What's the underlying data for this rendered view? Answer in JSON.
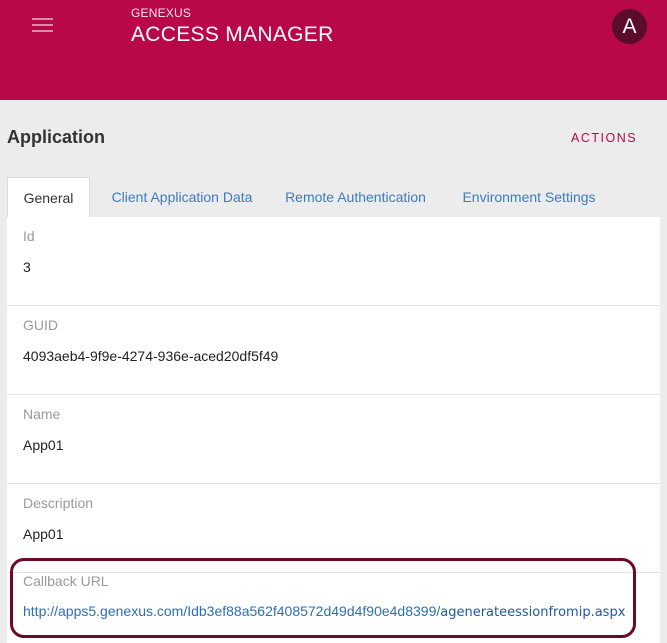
{
  "header": {
    "brand_small": "GENEXUS",
    "brand_large": "ACCESS MANAGER",
    "avatar_letter": "A",
    "accent_color": "#b8084a"
  },
  "page": {
    "title": "Application",
    "actions_label": "ACTIONS"
  },
  "tabs": [
    {
      "label": "General",
      "active": true
    },
    {
      "label": "Client Application Data",
      "active": false
    },
    {
      "label": "Remote Authentication",
      "active": false
    },
    {
      "label": "Environment Settings",
      "active": false
    }
  ],
  "fields": {
    "id": {
      "label": "Id",
      "value": "3"
    },
    "guid": {
      "label": "GUID",
      "value": "4093aeb4-9f9e-4274-936e-aced20df5f49"
    },
    "name": {
      "label": "Name",
      "value": "App01"
    },
    "description": {
      "label": "Description",
      "value": "App01"
    },
    "callback_url": {
      "label": "Callback URL",
      "value_main": "http://apps5.genexus.com/Idb3ef88a562f408572d49d4f90e4d8399/",
      "value_tail": "agenerateessionfromip.aspx"
    }
  }
}
